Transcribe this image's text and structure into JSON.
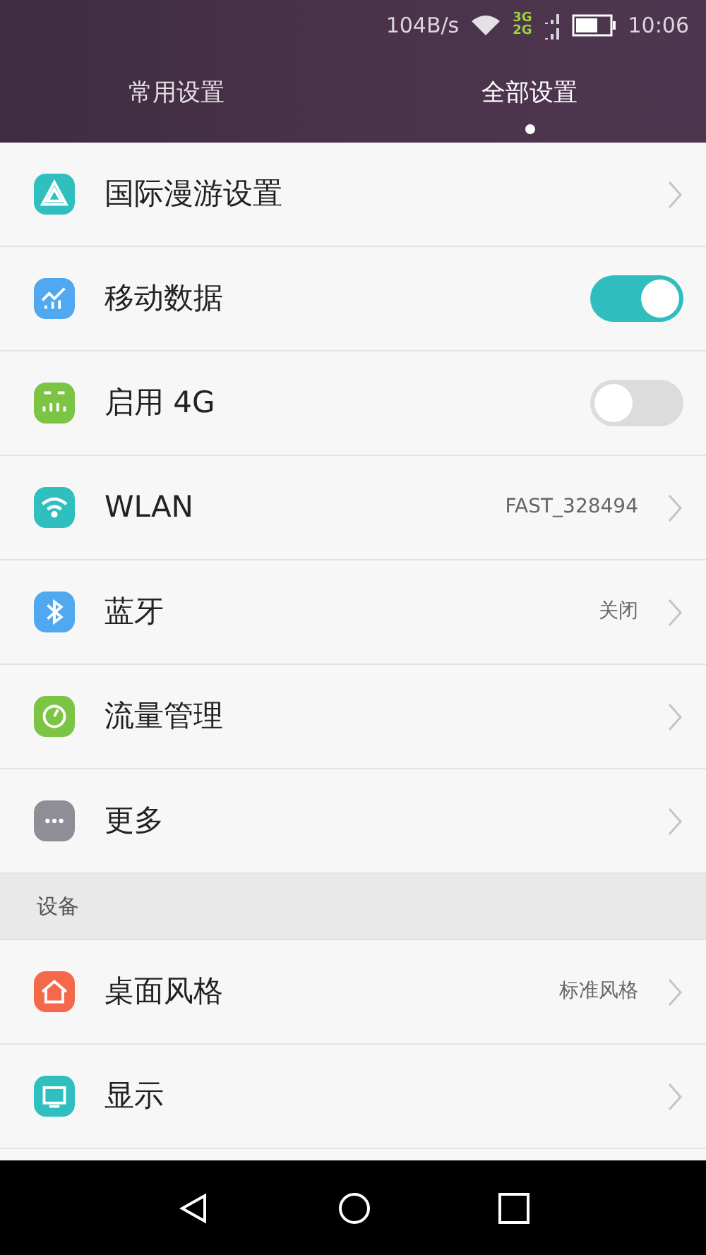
{
  "status_bar": {
    "speed": "104B/s",
    "network_top": "3G",
    "network_bottom": "2G",
    "time": "10:06"
  },
  "tabs": [
    {
      "label": "常用设置",
      "selected": false
    },
    {
      "label": "全部设置",
      "selected": true
    }
  ],
  "sections": [
    {
      "items": [
        {
          "label": "国际漫游设置",
          "kind": "link",
          "color": "#2fbfbf"
        },
        {
          "label": "移动数据",
          "kind": "toggle",
          "on": true,
          "color": "#4fa8f0"
        },
        {
          "label": "启用 4G",
          "kind": "toggle",
          "on": false,
          "color": "#7cc444"
        },
        {
          "label": "WLAN",
          "kind": "link",
          "value": "FAST_328494",
          "color": "#2fbfbf"
        },
        {
          "label": "蓝牙",
          "kind": "link",
          "value": "关闭",
          "color": "#4fa8f0"
        },
        {
          "label": "流量管理",
          "kind": "link",
          "color": "#7cc444"
        },
        {
          "label": "更多",
          "kind": "link",
          "color": "#8e8e96"
        }
      ]
    },
    {
      "header": "设备",
      "items": [
        {
          "label": "桌面风格",
          "kind": "link",
          "value": "标准风格",
          "color": "#f4694a"
        },
        {
          "label": "显示",
          "kind": "link",
          "color": "#2fbfbf"
        }
      ]
    }
  ]
}
